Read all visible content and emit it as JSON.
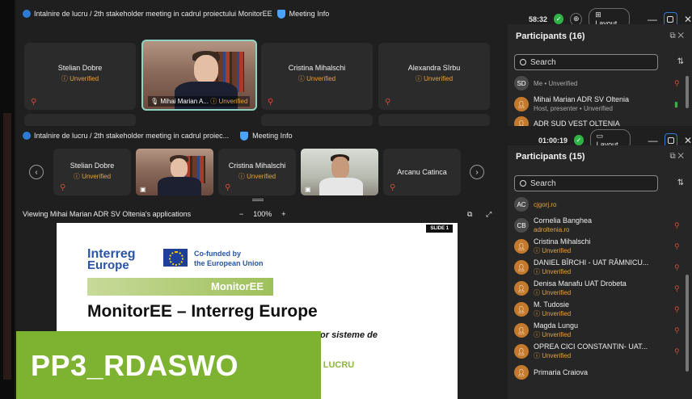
{
  "window_back": {
    "title": "Intalnire de lucru / 2th stakeholder meeting in cadrul proiectului MonitorEE",
    "meeting_info": "Meeting Info",
    "timer": "58:32",
    "layout_label": "Layout",
    "tiles": [
      {
        "name": "Stelian Dobre",
        "status": "Unverified"
      },
      {
        "name": "Mihai Marian A...",
        "status": "Unverified"
      },
      {
        "name": "Cristina Mihalschi",
        "status": "Unverified"
      },
      {
        "name": "Alexandra Sîrbu",
        "status": "Unverified"
      }
    ],
    "participants_title": "Participants (16)",
    "search_placeholder": "Search",
    "participants": [
      {
        "initials": "SD",
        "name": "",
        "sub": "Me • Unverified"
      },
      {
        "initials": "",
        "name": "Mihai Marian ADR SV Oltenia",
        "sub": "Host, presenter • Unverified"
      },
      {
        "initials": "",
        "name": "ADR SUD VEST OLTENIA",
        "sub": ""
      }
    ]
  },
  "window_front": {
    "title": "Intalnire de lucru / 2th stakeholder meeting in cadrul proiec...",
    "meeting_info": "Meeting Info",
    "timer": "01:00:19",
    "layout_label": "Layout",
    "tiles": [
      {
        "name": "Stelian Dobre",
        "status": "Unverified"
      },
      {
        "name": "Cristina Mihalschi",
        "status": "Unverified"
      },
      {
        "name": "Arcanu Catinca",
        "status": ""
      }
    ],
    "viewing_text": "Viewing Mihai Marian ADR SV Oltenia's applications",
    "zoom_minus": "−",
    "zoom_level": "100%",
    "zoom_plus": "+",
    "slide": {
      "tag": "SLIDE 1",
      "interreg_l1": "Interreg",
      "interreg_l2": "Europe",
      "cofunded_l1": "Co-funded by",
      "cofunded_l2": "the European Union",
      "band": "MonitorEE",
      "title": "MonitorEE – Interreg Europe",
      "subtitle": "diul unor sisteme de",
      "subtitle2": "IRE DE LUCRU"
    },
    "participants_title": "Participants (15)",
    "search_placeholder": "Search",
    "participants": [
      {
        "initials": "AC",
        "name": "",
        "sub": "cjgorj.ro",
        "subtype": "grey",
        "avatar": "grey"
      },
      {
        "initials": "CB",
        "name": "Cornelia Banghea",
        "sub": "adroltenia.ro",
        "subtype": "grey",
        "avatar": "grey"
      },
      {
        "initials": "",
        "name": "Cristina Mihalschi",
        "sub": "Unverified",
        "subtype": "orange",
        "avatar": "orange"
      },
      {
        "initials": "",
        "name": "DANIEL BÎRCHI - UAT RÂMNICU...",
        "sub": "Unverified",
        "subtype": "orange",
        "avatar": "orange"
      },
      {
        "initials": "",
        "name": "Denisa Manafu UAT Drobeta",
        "sub": "Unverified",
        "subtype": "orange",
        "avatar": "orange"
      },
      {
        "initials": "",
        "name": "M. Tudosie",
        "sub": "Unverified",
        "subtype": "orange",
        "avatar": "orange"
      },
      {
        "initials": "",
        "name": "Magda Lungu",
        "sub": "Unverified",
        "subtype": "orange",
        "avatar": "orange"
      },
      {
        "initials": "",
        "name": "OPREA CICI CONSTANTIN- UAT...",
        "sub": "Unverified",
        "subtype": "orange",
        "avatar": "orange"
      },
      {
        "initials": "",
        "name": "Primaria Craiova",
        "sub": "",
        "subtype": "orange",
        "avatar": "orange"
      }
    ]
  },
  "overlay_label": "PP3_RDASWO",
  "colors": {
    "accent_blue": "#2e7bd6",
    "unverified": "#e6a23c",
    "mic_off": "#e0443a",
    "green_status": "#2fb344",
    "overlay_green": "#7db330"
  }
}
